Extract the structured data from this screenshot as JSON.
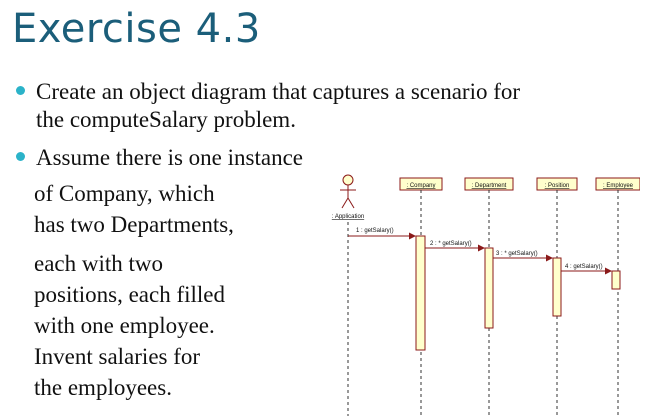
{
  "slide": {
    "title": "Exercise 4.3",
    "bullets": [
      {
        "line1": "Create an object diagram that captures a scenario for",
        "line2": "the computeSalary problem."
      },
      {
        "line1": "Assume there is one instance"
      }
    ],
    "continuation": [
      "of Company, which",
      "has two Departments,",
      "each with two",
      "positions, each filled",
      "with one employee.",
      "Invent salaries for",
      "the employees."
    ]
  },
  "diagram": {
    "actor": ": Application",
    "objects": [
      ": Company",
      ": Department",
      ": Position",
      ": Employee"
    ],
    "messages": [
      "1 : getSalary()",
      "2 : * getSalary()",
      "3 : * getSalary()",
      "4 : getSalary()"
    ],
    "colors": {
      "box_fill": "#ffffcc",
      "box_stroke": "#8b1a1a",
      "arrow": "#8b1a1a"
    }
  }
}
